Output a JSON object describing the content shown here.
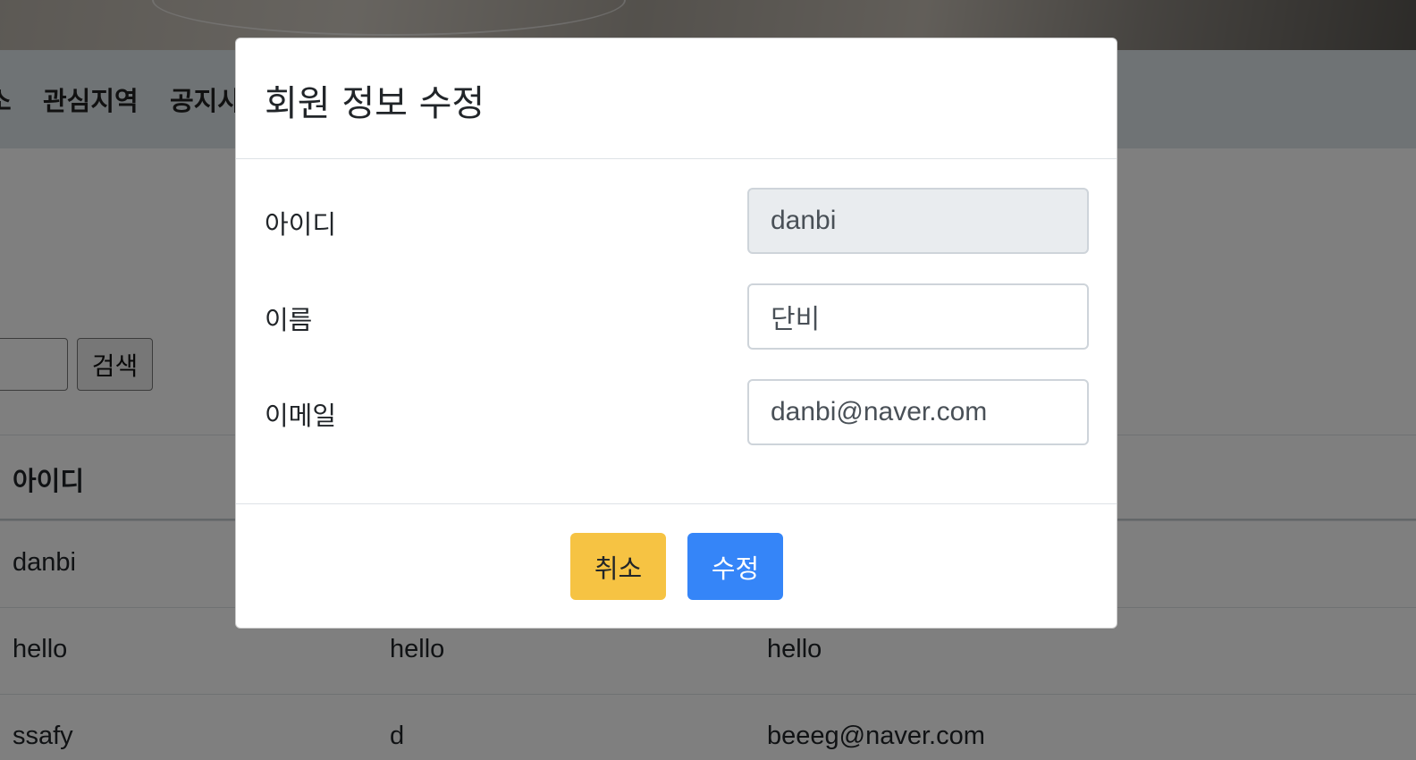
{
  "nav": {
    "items": [
      "소",
      "관심지역",
      "공지사"
    ]
  },
  "search": {
    "button_label": "검색",
    "input_value": ""
  },
  "table": {
    "headers": [
      "아이디",
      "",
      ""
    ],
    "rows": [
      [
        "danbi",
        "",
        ""
      ],
      [
        "hello",
        "hello",
        "hello"
      ],
      [
        "ssafy",
        "d",
        "beeeg@naver.com"
      ]
    ]
  },
  "modal": {
    "title": "회원 정보 수정",
    "fields": [
      {
        "label": "아이디",
        "value": "danbi",
        "readonly": true
      },
      {
        "label": "이름",
        "value": "단비",
        "readonly": false
      },
      {
        "label": "이메일",
        "value": "danbi@naver.com",
        "readonly": false
      }
    ],
    "cancel_label": "취소",
    "submit_label": "수정"
  },
  "colors": {
    "cancel": "#f6c343",
    "submit": "#3585f8",
    "backdrop": "rgba(0,0,0,0.5)"
  }
}
